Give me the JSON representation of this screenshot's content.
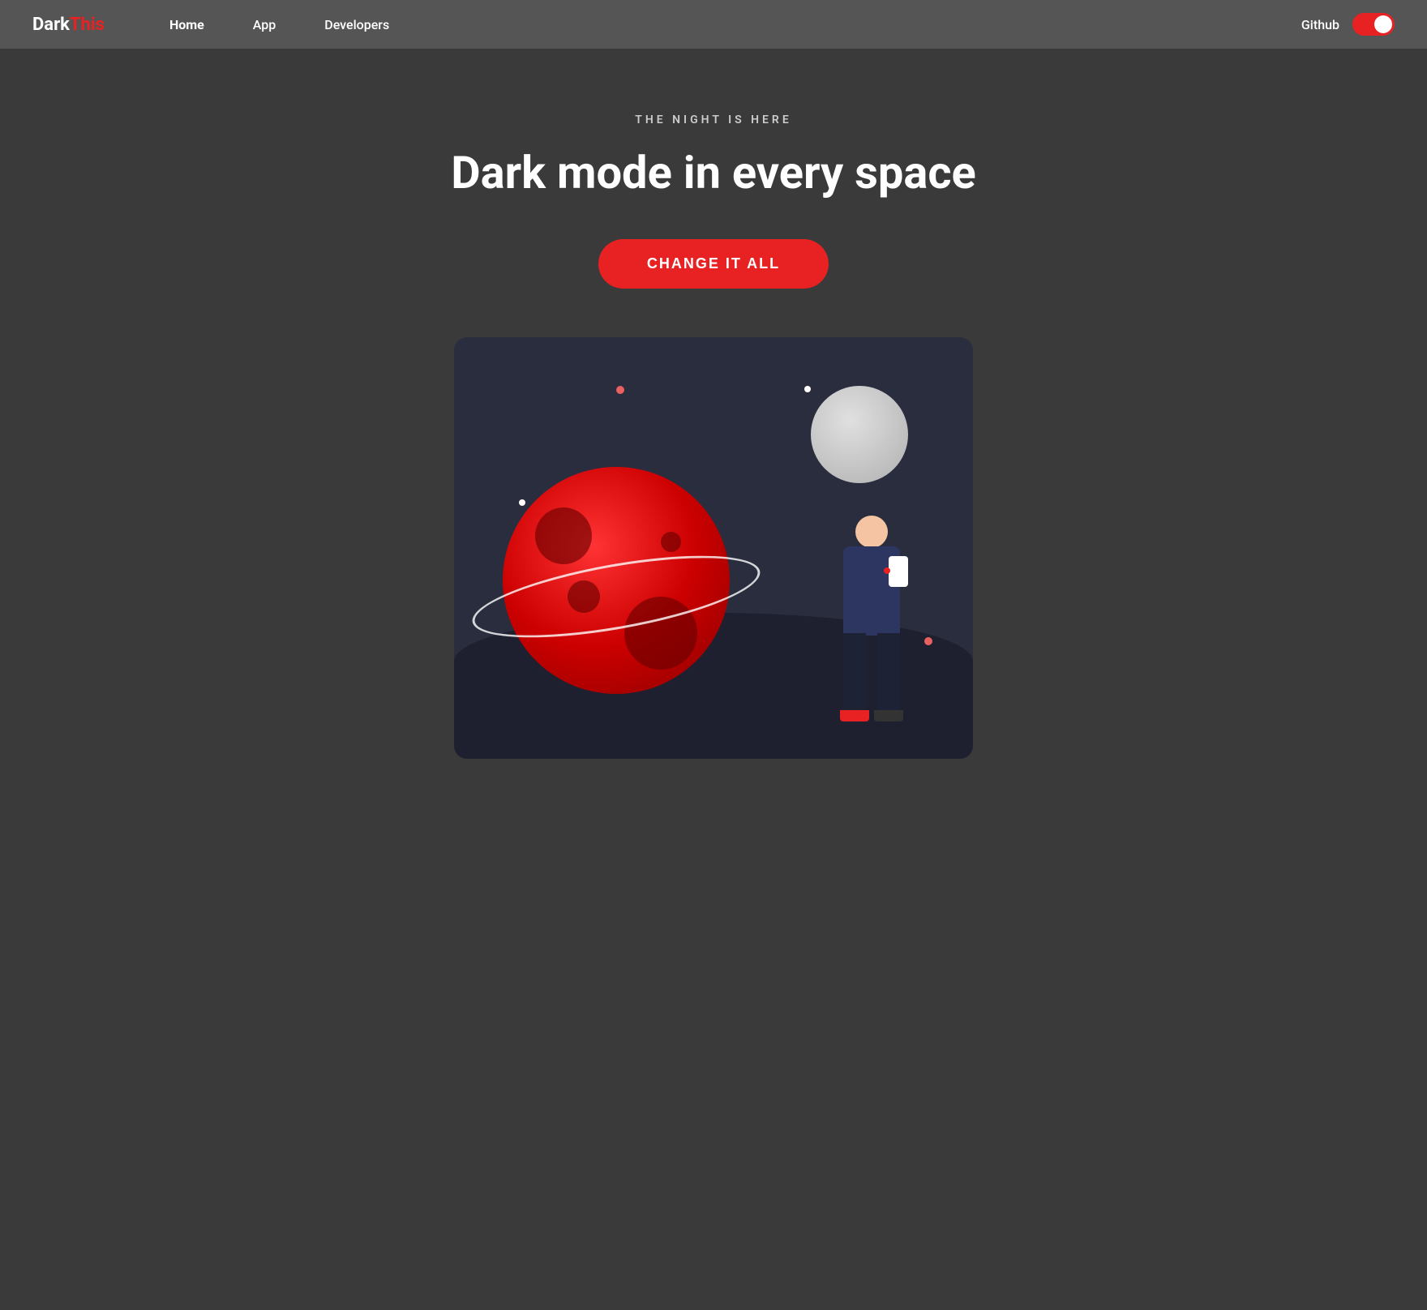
{
  "navbar": {
    "logo_dark": "Dark",
    "logo_this": "This",
    "links": [
      {
        "label": "Home",
        "active": true
      },
      {
        "label": "App",
        "active": false
      },
      {
        "label": "Developers",
        "active": false
      }
    ],
    "github_label": "Github",
    "toggle_label": "dark mode toggle"
  },
  "hero": {
    "subtitle": "THE NIGHT IS HERE",
    "title": "Dark mode in every space",
    "cta_label": "CHANGE IT ALL"
  },
  "illustration": {
    "alt": "Dark mode illustration with planet and person"
  },
  "colors": {
    "accent": "#e82222",
    "background": "#3a3a3a",
    "navbar_bg": "#555555",
    "illus_bg": "#2a2d3e"
  }
}
